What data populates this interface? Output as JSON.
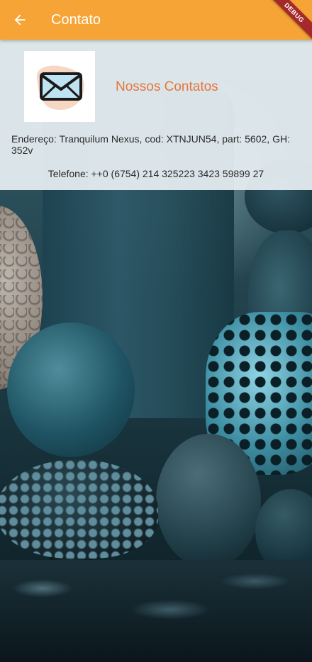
{
  "app_bar": {
    "title": "Contato",
    "back_icon": "arrow-back-icon",
    "color": "#f6a435",
    "debug_label": "DEBUG"
  },
  "contact": {
    "logo_icon": "envelope-icon",
    "heading": "Nossos Contatos",
    "heading_color": "#e5763c",
    "address": "Endereço: Tranquilum Nexus, cod: XTNJUN54, part: 5602, GH: 352v",
    "phone": "Telefone: ++0 (6754) 214 325223 3423 59899 27"
  }
}
